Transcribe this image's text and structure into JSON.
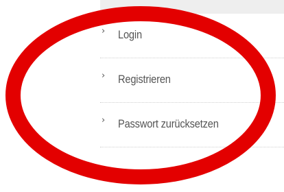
{
  "menu": {
    "items": [
      {
        "label": "Login",
        "icon": "chevron-right-icon"
      },
      {
        "label": "Registrieren",
        "icon": "chevron-right-icon"
      },
      {
        "label": "Passwort zurücksetzen",
        "icon": "chevron-right-icon"
      }
    ]
  },
  "colors": {
    "annotation_ring": "#e30000",
    "text": "#555555",
    "top_bar": "#eeeeee"
  }
}
